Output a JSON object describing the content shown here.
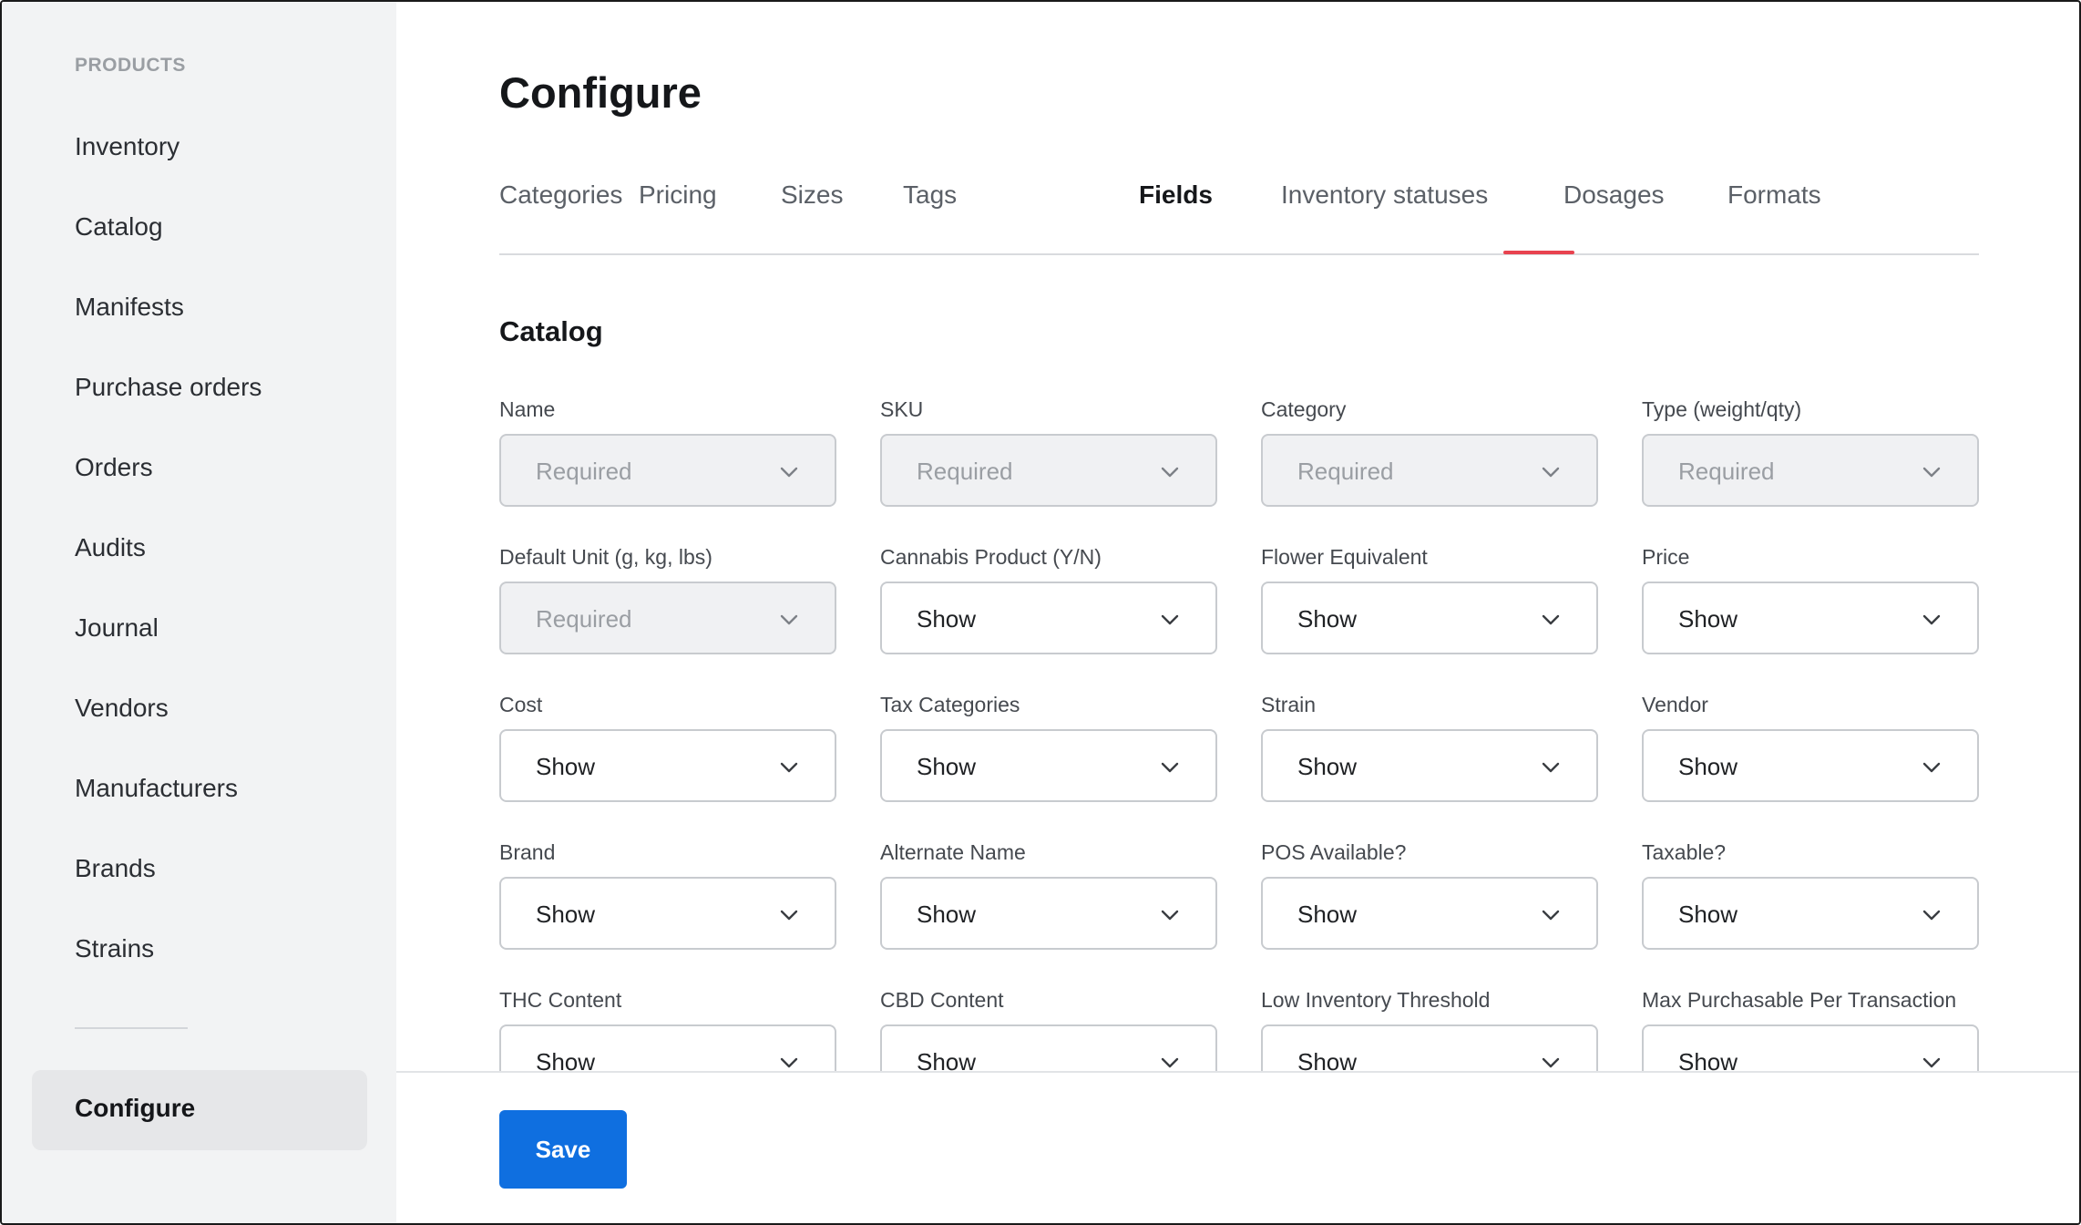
{
  "sidebar": {
    "heading": "PRODUCTS",
    "items": [
      {
        "label": "Inventory"
      },
      {
        "label": "Catalog"
      },
      {
        "label": "Manifests"
      },
      {
        "label": "Purchase orders"
      },
      {
        "label": "Orders"
      },
      {
        "label": "Audits"
      },
      {
        "label": "Journal"
      },
      {
        "label": "Vendors"
      },
      {
        "label": "Manufacturers"
      },
      {
        "label": "Brands"
      },
      {
        "label": "Strains"
      }
    ],
    "active_item": "Configure"
  },
  "page": {
    "title": "Configure"
  },
  "tabs": [
    {
      "label": "Categories"
    },
    {
      "label": "Pricing"
    },
    {
      "label": "Sizes"
    },
    {
      "label": "Tags"
    },
    {
      "label": "Fields",
      "active": true
    },
    {
      "label": "Inventory statuses"
    },
    {
      "label": "Dosages"
    },
    {
      "label": "Formats"
    }
  ],
  "section": {
    "title": "Catalog"
  },
  "fields": [
    {
      "label": "Name",
      "value": "Required",
      "disabled": true
    },
    {
      "label": "SKU",
      "value": "Required",
      "disabled": true
    },
    {
      "label": "Category",
      "value": "Required",
      "disabled": true
    },
    {
      "label": "Type (weight/qty)",
      "value": "Required",
      "disabled": true
    },
    {
      "label": "Default Unit (g, kg, lbs)",
      "value": "Required",
      "disabled": true
    },
    {
      "label": "Cannabis Product (Y/N)",
      "value": "Show",
      "disabled": false
    },
    {
      "label": "Flower Equivalent",
      "value": "Show",
      "disabled": false
    },
    {
      "label": "Price",
      "value": "Show",
      "disabled": false
    },
    {
      "label": "Cost",
      "value": "Show",
      "disabled": false
    },
    {
      "label": "Tax Categories",
      "value": "Show",
      "disabled": false
    },
    {
      "label": "Strain",
      "value": "Show",
      "disabled": false
    },
    {
      "label": "Vendor",
      "value": "Show",
      "disabled": false
    },
    {
      "label": "Brand",
      "value": "Show",
      "disabled": false
    },
    {
      "label": "Alternate Name",
      "value": "Show",
      "disabled": false
    },
    {
      "label": "POS Available?",
      "value": "Show",
      "disabled": false
    },
    {
      "label": "Taxable?",
      "value": "Show",
      "disabled": false
    },
    {
      "label": "THC Content",
      "value": "Show",
      "disabled": false
    },
    {
      "label": "CBD Content",
      "value": "Show",
      "disabled": false
    },
    {
      "label": "Low Inventory Threshold",
      "value": "Show",
      "disabled": false
    },
    {
      "label": "Max Purchasable Per Transaction",
      "value": "Show",
      "disabled": false
    }
  ],
  "footer": {
    "save_label": "Save"
  },
  "colors": {
    "accent_tab": "#e8434f",
    "primary_button": "#0f6fe0"
  }
}
